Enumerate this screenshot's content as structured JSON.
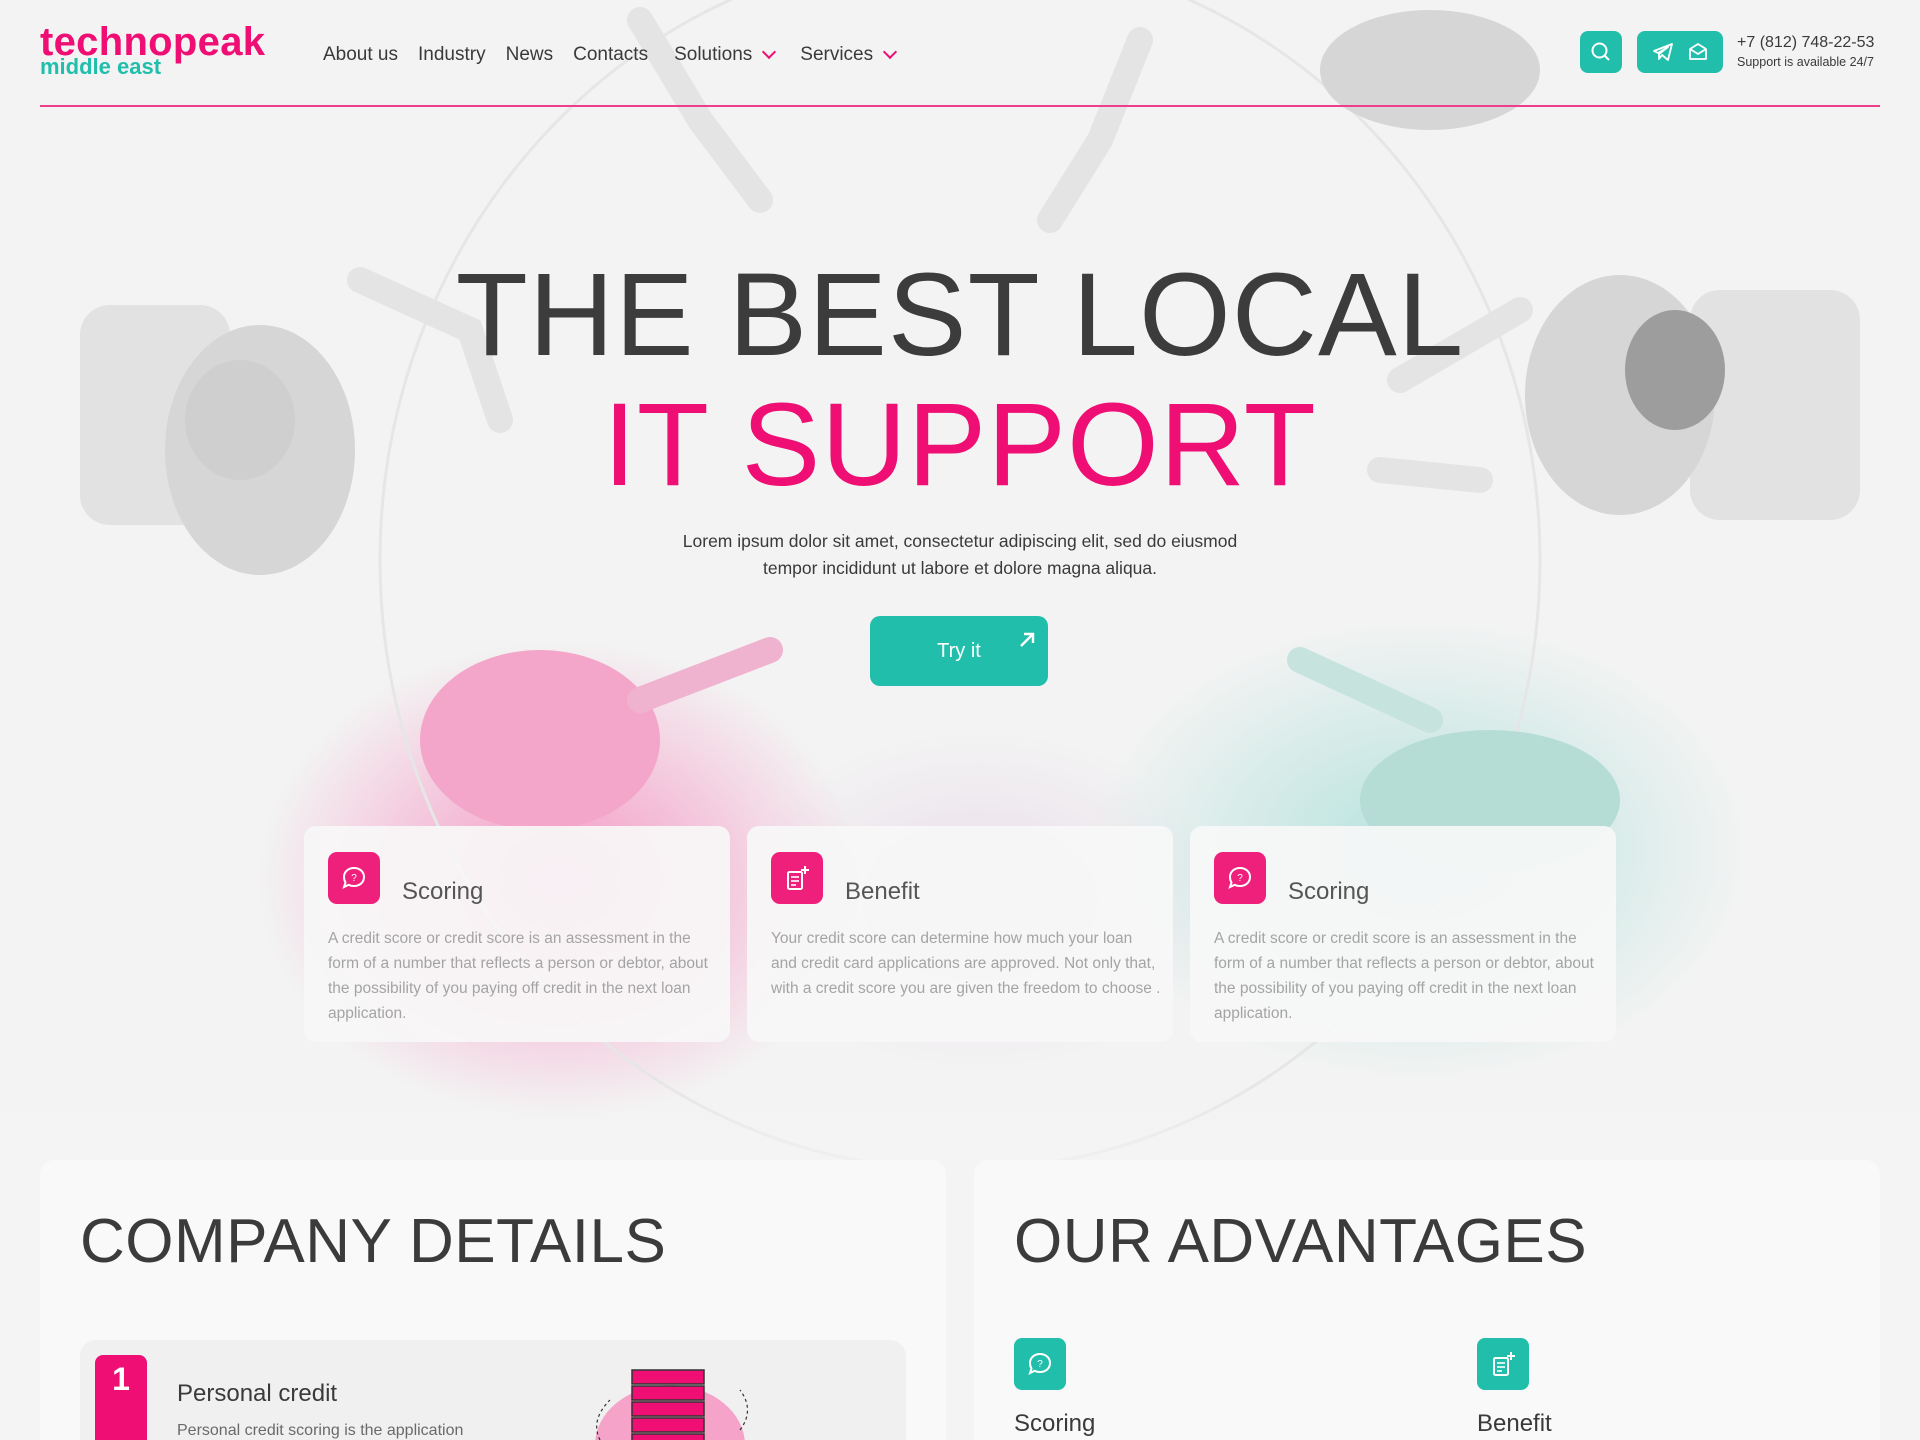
{
  "brand": {
    "line1": "technopeak",
    "line2": "middle east"
  },
  "nav": [
    {
      "label": "About us"
    },
    {
      "label": "Industry"
    },
    {
      "label": "News"
    },
    {
      "label": "Contacts"
    },
    {
      "label": "Solutions"
    },
    {
      "label": "Services"
    }
  ],
  "header_icons": [
    "search-icon",
    "telegram-icon",
    "mail-icon"
  ],
  "contact": {
    "phone": "+7 (812) 748-22-53",
    "support": "Support is available 24/7"
  },
  "hero": {
    "title_line1": "THE BEST LOCAL",
    "title_line2": "IT SUPPORT",
    "lead": "Lorem ipsum dolor sit amet, consectetur adipiscing elit, sed do eiusmod tempor incididunt ut labore et dolore magna aliqua.",
    "cta": "Try it"
  },
  "cards": [
    {
      "title": "Scoring",
      "icon": "chat-question-icon",
      "text": "A credit score or credit score is an assessment in the form of a number that reflects a person or debtor, about the possibility of you paying off credit in the next loan application."
    },
    {
      "title": "Benefit",
      "icon": "document-plus-icon",
      "text": "Your credit score can determine how much your loan and credit card applications are approved. Not only that, with a credit score you are given the freedom to choose ."
    },
    {
      "title": "Scoring",
      "icon": "chat-question-icon",
      "text": "A credit score or credit score is an assessment in the form of a number that reflects a person or debtor, about the possibility of you paying off credit in the next loan application."
    }
  ],
  "company": {
    "title": "COMPANY DETAILS",
    "item": {
      "number": "1",
      "title": "Personal credit",
      "text": "Personal credit scoring is the application"
    }
  },
  "advantages": {
    "title": "OUR ADVANTAGES",
    "items": [
      {
        "title": "Scoring",
        "icon": "chat-question-icon"
      },
      {
        "title": "Benefit",
        "icon": "document-plus-icon"
      }
    ]
  },
  "colors": {
    "brand_pink": "#ef0f74",
    "brand_teal": "#21bfab",
    "text_dark": "#3c3c3c"
  }
}
